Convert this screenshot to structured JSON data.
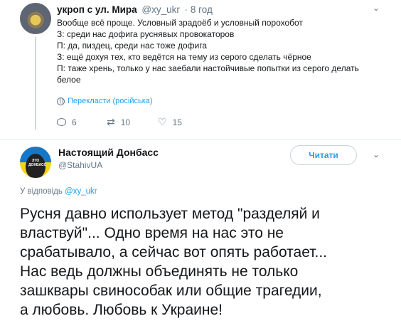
{
  "tweet1": {
    "name": "укроп с ул. Мира",
    "handle": "@xy_ukr",
    "time": "· 8 год",
    "lines": [
      "Вообще всё проще. Условный зрадоёб и условный порохобот",
      "З: среди нас дофига руснявых провокаторов",
      "П: да, пиздец, среди нас тоже дофига",
      "З: ещё дохуя тех, кто ведётся на тему из серого сделать чёрное",
      "П: таже хрень, только у нас заебали настойчивые попытки из серого делать",
      "белое"
    ],
    "translate_label": "Перекласти (російська)",
    "reply_count": "6",
    "retweet_count": "10",
    "like_count": "15"
  },
  "tweet2": {
    "name": "Настоящий Донбасс",
    "handle": "@StahivUA",
    "follow_label": "Читати",
    "replying_prefix": "У відповідь",
    "replying_handle": "@xy_ukr",
    "lines": [
      "Русня давно использует метод \"разделяй и",
      "властвуй\"...  Одно время на нас это не",
      "срабатывало,  а сейчас вот опять работает...",
      "Нас ведь должны объединять не только",
      "зашквары свинособак или общие трагедии,",
      "а любовь.  Любовь к Украине!"
    ],
    "avatar_text": "ЭТО ДОНБАСС"
  },
  "colors": {
    "link": "#1da1f2",
    "muted": "#657786",
    "text": "#14171a"
  }
}
